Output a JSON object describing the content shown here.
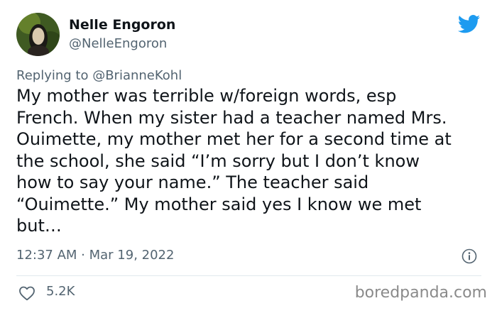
{
  "author": {
    "display_name": "Nelle Engoron",
    "handle": "@NelleEngoron"
  },
  "reply": {
    "prefix": "Replying to ",
    "target": "@BrianneKohl"
  },
  "tweet": {
    "text": "My mother was terrible w/foreign words, esp\nFrench. When my sister had a teacher named Mrs.\nOuimette, my mother met her for a second time at\nthe school, she said “I’m sorry but I don’t know\nhow to say your name.” The teacher said\n“Ouimette.” My mother said yes I know we met\nbut…",
    "timestamp": "12:37 AM · Mar 19, 2022"
  },
  "stats": {
    "likes": "5.2K"
  },
  "watermark": "boredpanda.com",
  "icons": {
    "brand": "twitter-bird-icon",
    "info": "info-icon",
    "like": "heart-icon"
  },
  "colors": {
    "twitter_blue": "#1d9bf0",
    "text": "#0f1419",
    "secondary": "#536471",
    "divider": "#e1e8ed"
  }
}
